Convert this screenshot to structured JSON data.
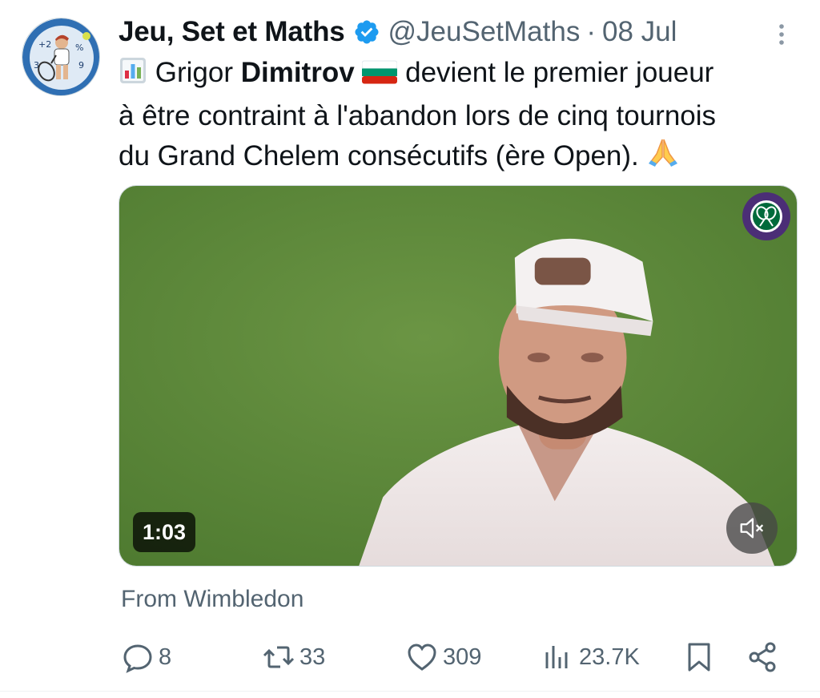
{
  "author": {
    "display_name": "Jeu, Set et Maths",
    "handle": "@JeuSetMaths",
    "separator": "·",
    "date": "08 Jul",
    "verified": true
  },
  "tweet": {
    "line1_pre": "Grigor ",
    "line1_bold": "Dimitrov",
    "line1_post": " devient le premier joueur",
    "line2": "à être contraint à l'abandon lors de cinq tournois",
    "line3": "du Grand Chelem consécutifs (ère Open).",
    "emojis": [
      "bar-chart-emoji",
      "bulgaria-flag-emoji",
      "folded-hands-emoji"
    ]
  },
  "media": {
    "duration": "1:03",
    "muted": true,
    "logo": "wimbledon-logo"
  },
  "source": "From Wimbledon",
  "actions": {
    "replies": "8",
    "retweets": "33",
    "likes": "309",
    "views": "23.7K"
  },
  "colors": {
    "text": "#0f1419",
    "secondary": "#536471",
    "verified": "#1d9bf0",
    "grass": "#5f8a3c"
  }
}
